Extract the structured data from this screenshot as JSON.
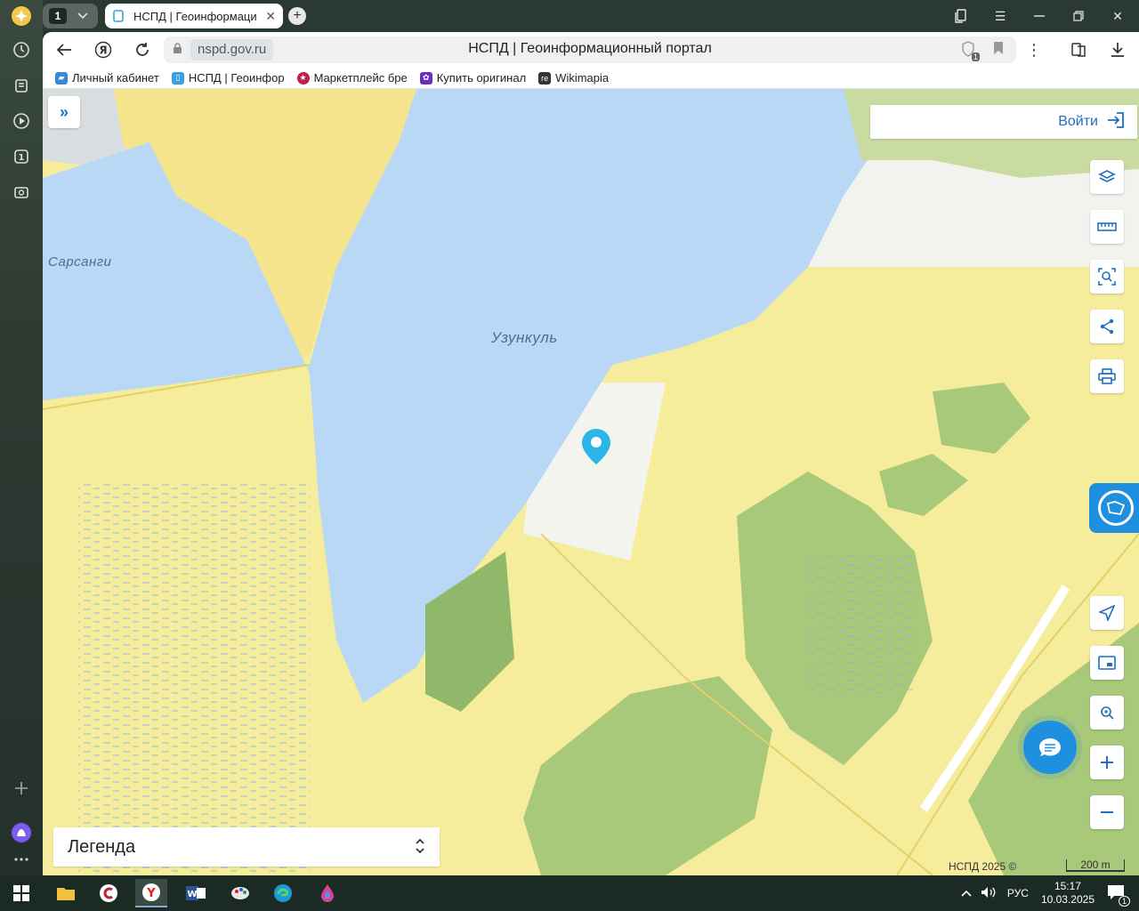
{
  "browser": {
    "tab_count": "1",
    "active_tab_title": "НСПД | Геоинформаци",
    "url_domain": "nspd.gov.ru",
    "page_title": "НСПД | Геоинформационный портал",
    "shield_count": "1"
  },
  "bookmarks": [
    {
      "label": "Личный кабинет",
      "color": "#3a88d8"
    },
    {
      "label": "НСПД | Геоинфор",
      "color": "#3aa0e0"
    },
    {
      "label": "Маркетплейс бре",
      "color": "#c02050"
    },
    {
      "label": "Купить оригинал",
      "color": "#6a2ec0"
    },
    {
      "label": "Wikimapia",
      "color": "#333333",
      "icon_text": "re"
    }
  ],
  "map": {
    "labels": {
      "town": "Сарсанги",
      "lake": "Узункуль"
    },
    "login_label": "Войти",
    "legend_label": "Легенда",
    "copyright": "НСПД 2025 ©",
    "scale": "200 m",
    "colors": {
      "water": "#b9d8f5",
      "field": "#f5ed9c",
      "forest": "#a8c87a",
      "urban": "#f2e27a",
      "accent": "#1f8fe0"
    }
  },
  "tools": [
    {
      "name": "layers-icon"
    },
    {
      "name": "ruler-icon"
    },
    {
      "name": "search-area-icon"
    },
    {
      "name": "share-icon"
    },
    {
      "name": "print-icon"
    },
    {
      "name": "navigate-icon"
    },
    {
      "name": "minimap-icon"
    },
    {
      "name": "locate-icon"
    },
    {
      "name": "zoom-in-icon"
    },
    {
      "name": "zoom-out-icon"
    }
  ],
  "taskbar": {
    "language": "РУС",
    "time": "15:17",
    "date": "10.03.2025",
    "notifications": "1"
  }
}
